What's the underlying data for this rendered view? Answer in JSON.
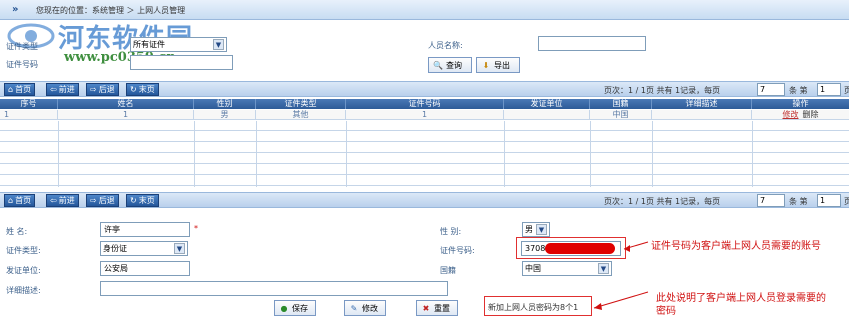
{
  "topbar": {
    "breadcrumb": "您现在的位置：系统管理 ＞ 上网人员管理"
  },
  "watermark": {
    "title": "河东软件园",
    "url": "www.pc0359.cn"
  },
  "search": {
    "cert_type_label": "证件类型",
    "cert_type_value": "所有证件",
    "cert_no_label": "证件号码",
    "cert_no_value": "",
    "person_name_label": "人员名称:",
    "person_name_value": "",
    "query_label": "查询",
    "export_label": "导出"
  },
  "pager": {
    "first": "首页",
    "prev": "前进",
    "next": "后退",
    "last": "末页",
    "info1": "页次：1 / 1页 共有 1记录，每页",
    "per_page": "7",
    "info2": "条 第",
    "page_no": "1",
    "info3": "页"
  },
  "grid": {
    "headers": [
      "序号",
      "姓名",
      "性别",
      "证件类型",
      "证件号码",
      "发证单位",
      "国籍",
      "详细描述",
      "操作"
    ],
    "rows": [
      {
        "seq": "1",
        "name": "1",
        "gender": "男",
        "cert_type": "其他",
        "cert_no": "1",
        "issuer": "",
        "country": "中国",
        "desc": "",
        "op_edit": "修改",
        "op_delete": "删除"
      }
    ]
  },
  "form": {
    "name_label": "姓 名:",
    "name_value": "许亭",
    "required_mark": "*",
    "gender_label": "性 别:",
    "gender_value": "男",
    "cert_type_label": "证件类型:",
    "cert_type_value": "身份证",
    "cert_no_label": "证件号码:",
    "cert_no_value": "3708",
    "issuer_label": "发证单位:",
    "issuer_value": "公安局",
    "country_label": "国籍",
    "country_value": "中国",
    "desc_label": "详细描述:",
    "desc_value": "",
    "save_label": "保存",
    "edit_label": "修改",
    "reset_label": "重置",
    "password_note": "新加上网人员密码为8个1"
  },
  "annotations": {
    "cert_note": "证件号码为客户端上网人员需要的账号",
    "pwd_note_line1": "此处说明了客户端上网人员登录需要的",
    "pwd_note_line2": "密码"
  }
}
